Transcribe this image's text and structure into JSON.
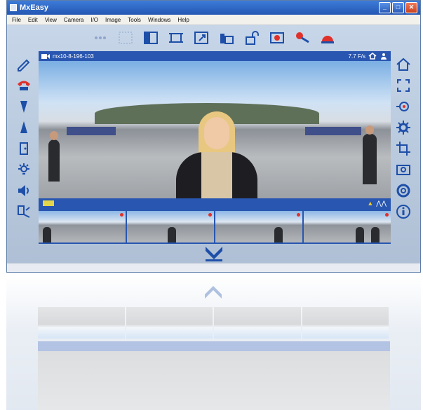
{
  "window": {
    "title": "MxEasy",
    "controls": [
      "_",
      "□",
      "✕"
    ]
  },
  "menu": [
    "File",
    "Edit",
    "View",
    "Camera",
    "I/O",
    "Image",
    "Tools",
    "Windows",
    "Help"
  ],
  "toolbar": {
    "icons": [
      "dots-icon",
      "grid-select-icon",
      "layout-icon",
      "crop-icon",
      "resize-icon",
      "camera-group-icon",
      "unlock-icon",
      "record-icon",
      "audio-icon",
      "alarm-bell-icon"
    ]
  },
  "viewer": {
    "camera_name": "mx10-8-196-103",
    "fps": "7.7 F/s"
  },
  "left_sidebar": [
    "draw-icon",
    "phone-icon",
    "zoom-out-icon",
    "zoom-in-icon",
    "door-icon",
    "light-icon",
    "speaker-icon",
    "settings-tools-icon"
  ],
  "right_sidebar": [
    "home-icon",
    "expand-icon",
    "target-icon",
    "gear-icon",
    "crop-icon",
    "snapshot-icon",
    "help-ring-icon",
    "info-icon"
  ],
  "thumbnails_count": 4,
  "colors": {
    "titlebar": "#2457b4",
    "viewer_frame": "#2856b0",
    "accent_red": "#e0302a",
    "warning_yellow": "#f3c72b"
  }
}
